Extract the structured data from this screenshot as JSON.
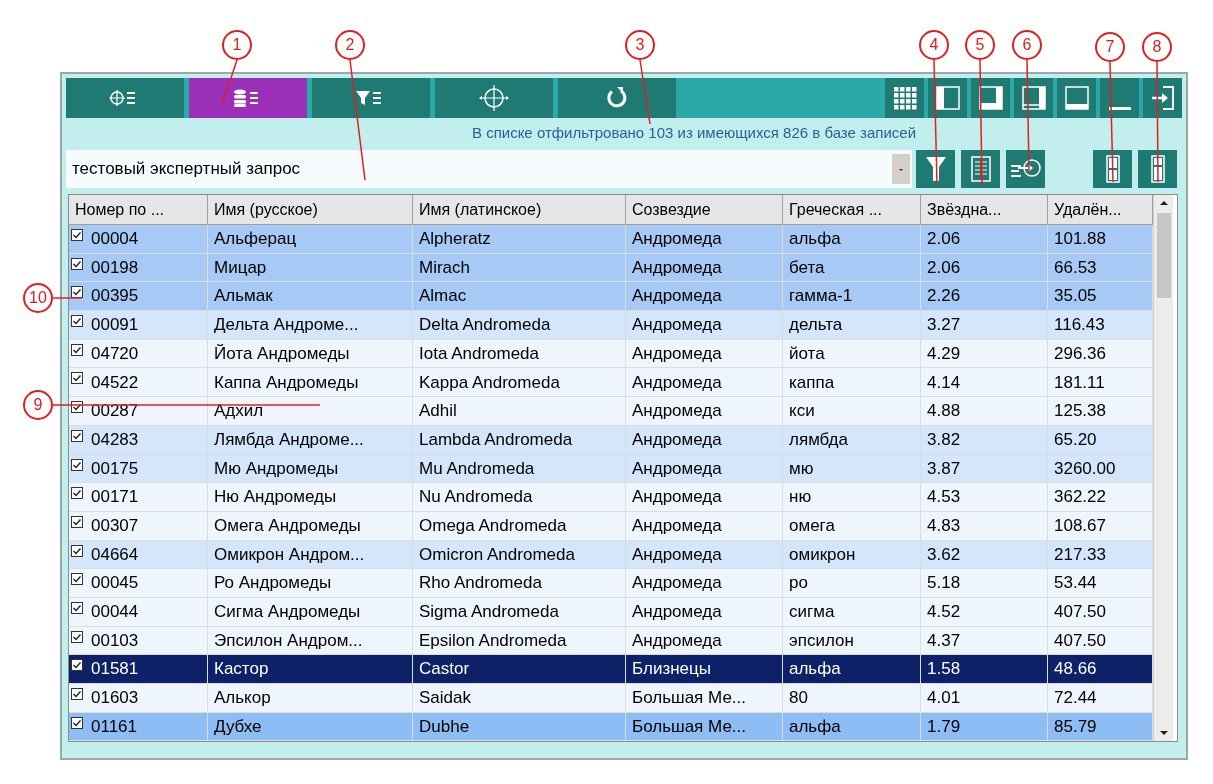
{
  "toolbar": {
    "tabs": [
      {
        "kind": "target-list",
        "selected": false
      },
      {
        "kind": "database-list",
        "selected": true
      },
      {
        "kind": "filter-list",
        "selected": false
      },
      {
        "kind": "crosshair",
        "selected": false
      },
      {
        "kind": "refresh",
        "selected": false
      }
    ],
    "view_buttons": [
      {
        "kind": "grid"
      },
      {
        "kind": "left-panel"
      },
      {
        "kind": "bottom-panel"
      },
      {
        "kind": "right-panel"
      },
      {
        "kind": "top-panel"
      },
      {
        "kind": "minimize"
      },
      {
        "kind": "exit"
      }
    ]
  },
  "status": "В списке отфильтровано 103 из имеющихся 826 в базе записей",
  "query": {
    "value": "тестовый экспертный запрос"
  },
  "tool_buttons": [
    {
      "kind": "filter"
    },
    {
      "kind": "marked-list"
    },
    {
      "kind": "export"
    },
    {
      "kind": "split-top"
    },
    {
      "kind": "split-bottom"
    }
  ],
  "table": {
    "columns": [
      "Номер по ...",
      "Имя (русское)",
      "Имя (латинское)",
      "Созвездие",
      "Греческая ...",
      "Звёздна...",
      "Удалён..."
    ],
    "rows": [
      {
        "checked": true,
        "selected": false,
        "color": "#a6c9f6",
        "cells": [
          "00004",
          "Альферац",
          "Alpheratz",
          "Андромеда",
          "альфа",
          "2.06",
          "101.88"
        ]
      },
      {
        "checked": true,
        "selected": false,
        "color": "#a6c9f6",
        "cells": [
          "00198",
          "Мицар",
          "Mirach",
          "Андромеда",
          "бета",
          "2.06",
          "66.53"
        ]
      },
      {
        "checked": true,
        "selected": false,
        "color": "#a6c9f6",
        "cells": [
          "00395",
          "Альмак",
          "Almac",
          "Андромеда",
          "гамма-1",
          "2.26",
          "35.05"
        ]
      },
      {
        "checked": true,
        "selected": false,
        "color": "#d3e6fb",
        "cells": [
          "00091",
          "Дельта Андроме...",
          "Delta Andromeda",
          "Андромеда",
          "дельта",
          "3.27",
          "116.43"
        ]
      },
      {
        "checked": true,
        "selected": false,
        "color": "#eef5fd",
        "cells": [
          "04720",
          "Йота Андромеды",
          "Iota Andromeda",
          "Андромеда",
          "йота",
          "4.29",
          "296.36"
        ]
      },
      {
        "checked": true,
        "selected": false,
        "color": "#eef5fd",
        "cells": [
          "04522",
          "Каппа Андромеды",
          "Kappa Andromeda",
          "Андромеда",
          "каппа",
          "4.14",
          "181.11"
        ]
      },
      {
        "checked": true,
        "selected": false,
        "color": "#eef5fd",
        "cells": [
          "00287",
          "Адхил",
          "Adhil",
          "Андромеда",
          "кси",
          "4.88",
          "125.38"
        ]
      },
      {
        "checked": true,
        "selected": false,
        "color": "#d3e6fb",
        "cells": [
          "04283",
          "Лямбда Андроме...",
          "Lambda Andromeda",
          "Андромеда",
          "лямбда",
          "3.82",
          "65.20"
        ]
      },
      {
        "checked": true,
        "selected": false,
        "color": "#d3e6fb",
        "cells": [
          "00175",
          "Мю Андромеды",
          "Mu Andromeda",
          "Андромеда",
          "мю",
          "3.87",
          "3260.00"
        ]
      },
      {
        "checked": true,
        "selected": false,
        "color": "#eef5fd",
        "cells": [
          "00171",
          "Ню Андромеды",
          "Nu Andromeda",
          "Андромеда",
          "ню",
          "4.53",
          "362.22"
        ]
      },
      {
        "checked": true,
        "selected": false,
        "color": "#eef5fd",
        "cells": [
          "00307",
          "Омега Андромеды",
          "Omega Andromeda",
          "Андромеда",
          "омега",
          "4.83",
          "108.67"
        ]
      },
      {
        "checked": true,
        "selected": false,
        "color": "#d3e6fb",
        "cells": [
          "04664",
          "Омикрон Андром...",
          "Omicron Andromeda",
          "Андромеда",
          "омикрон",
          "3.62",
          "217.33"
        ]
      },
      {
        "checked": true,
        "selected": false,
        "color": "#eef5fd",
        "cells": [
          "00045",
          "Ро Андромеды",
          "Rho Andromeda",
          "Андромеда",
          "ро",
          "5.18",
          "53.44"
        ]
      },
      {
        "checked": true,
        "selected": false,
        "color": "#eef5fd",
        "cells": [
          "00044",
          "Сигма Андромеды",
          "Sigma Andromeda",
          "Андромеда",
          "сигма",
          "4.52",
          "407.50"
        ]
      },
      {
        "checked": true,
        "selected": false,
        "color": "#eef5fd",
        "cells": [
          "00103",
          "Эпсилон Андром...",
          "Epsilon Andromeda",
          "Андромеда",
          "эпсилон",
          "4.37",
          "407.50"
        ]
      },
      {
        "checked": true,
        "selected": true,
        "color": "#0c2168",
        "cells": [
          "01581",
          "Кастор",
          "Castor",
          "Близнецы",
          "альфа",
          "1.58",
          "48.66"
        ]
      },
      {
        "checked": true,
        "selected": false,
        "color": "#eef5fd",
        "cells": [
          "01603",
          "Алькор",
          "Saidak",
          "Большая Ме...",
          "80",
          "4.01",
          "72.44"
        ]
      },
      {
        "checked": true,
        "selected": false,
        "color": "#8ebcf4",
        "cells": [
          "01161",
          "Дубхе",
          "Dubhe",
          "Большая Ме...",
          "альфа",
          "1.79",
          "85.79"
        ]
      }
    ]
  },
  "callouts": [
    {
      "label": "1"
    },
    {
      "label": "2"
    },
    {
      "label": "3"
    },
    {
      "label": "4"
    },
    {
      "label": "5"
    },
    {
      "label": "6"
    },
    {
      "label": "7"
    },
    {
      "label": "8"
    },
    {
      "label": "9"
    },
    {
      "label": "10"
    }
  ]
}
